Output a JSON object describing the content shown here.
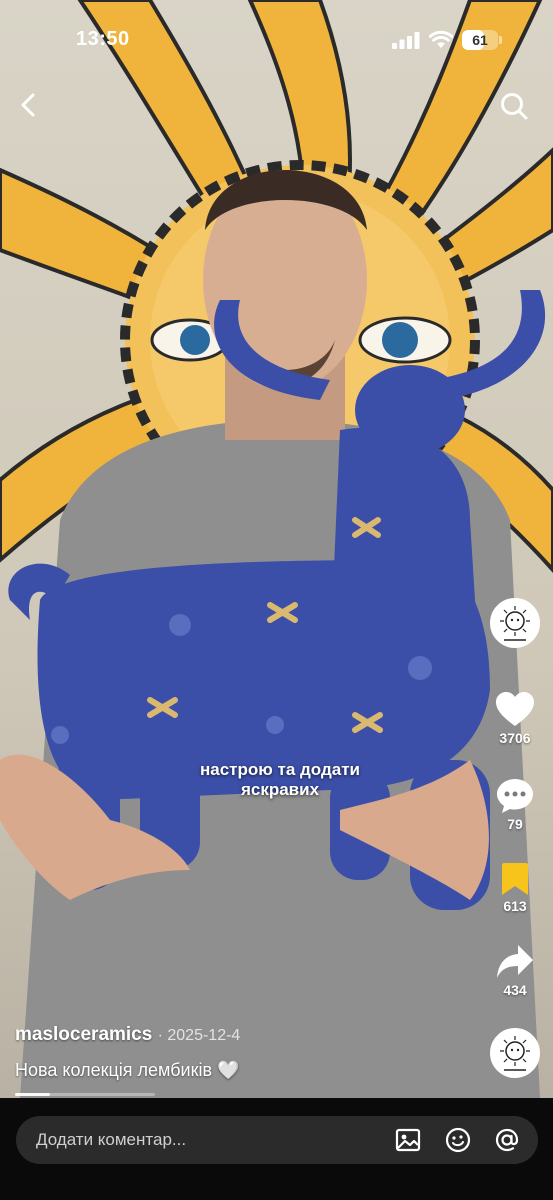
{
  "status_bar": {
    "time": "13:50",
    "battery_level": "61",
    "battery_fraction": 0.61
  },
  "nav": {
    "back_icon": "chevron-left-icon",
    "search_icon": "search-icon"
  },
  "video": {
    "overlay_caption": "настрою та додати яскравих"
  },
  "actions": {
    "likes": "3706",
    "comments": "79",
    "saves": "613",
    "shares": "434"
  },
  "post": {
    "author": "masloceramics",
    "date": "· 2025-12-4",
    "description": "Нова колекція лембиків 🤍",
    "progress": 0.25
  },
  "comment_bar": {
    "placeholder": "Додати коментар...",
    "icons": [
      "image-icon",
      "emoji-icon",
      "mention-icon"
    ]
  },
  "colors": {
    "accent_save": "#f7c41b",
    "bull_blue": "#3b4fa8",
    "sun_yellow": "#f0b43c"
  }
}
